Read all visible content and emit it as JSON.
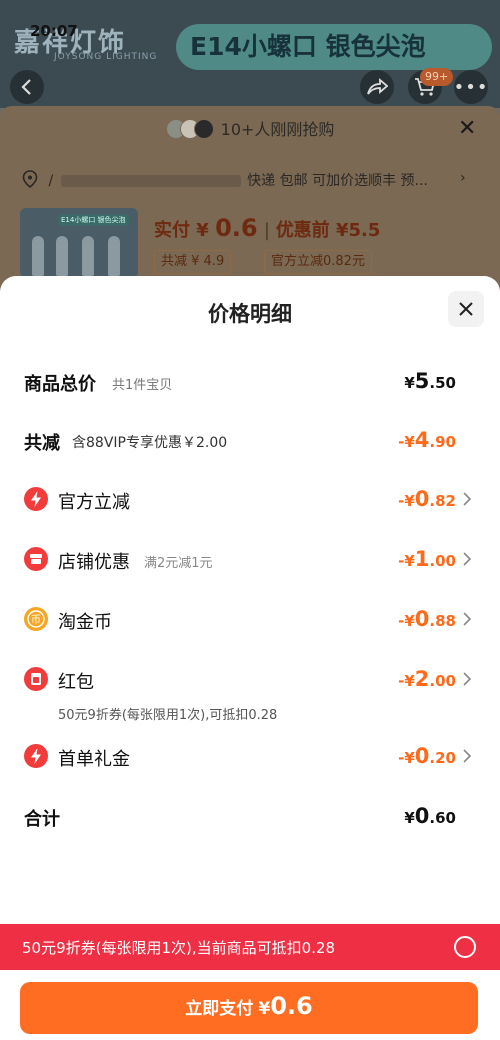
{
  "status_bar": {
    "time": "20:07"
  },
  "background_page": {
    "brand_logo_text": "嘉祥灯饰",
    "brand_logo_sub": "JOYSONG LIGHTING",
    "banner_text": "E14小螺口 银色尖泡",
    "cart_badge": "99+",
    "rush_text": "10+人刚刚抢购",
    "address_prefix": "/",
    "shipping_text": "快递 包邮 可加价选顺丰 预...",
    "product_img_tag": "E14小螺口 银色尖泡",
    "price_label": "实付",
    "price_currency": "¥",
    "price_value": "0.6",
    "price_before_label": "优惠前",
    "price_before_value": "¥5.5",
    "chips": [
      "共减 ¥ 4.9",
      "官方立减0.82元"
    ]
  },
  "modal": {
    "title": "价格明细",
    "total": {
      "label": "商品总价",
      "sub": "共1件宝贝",
      "currency": "¥",
      "int": "5",
      "dec": ".50"
    },
    "reduce": {
      "label": "共减",
      "sub": "含88VIP专享优惠￥2.00",
      "prefix": "-¥",
      "int": "4",
      "dec": ".90"
    },
    "items": [
      {
        "label": "官方立减",
        "sub": "",
        "prefix": "-¥",
        "int": "0",
        "dec": ".82",
        "icon": "lightning-icon",
        "color": "#f23b3b"
      },
      {
        "label": "店铺优惠",
        "sub": "满2元减1元",
        "prefix": "-¥",
        "int": "1",
        "dec": ".00",
        "icon": "shop-icon",
        "color": "#f23b3b"
      },
      {
        "label": "淘金币",
        "sub": "",
        "prefix": "-¥",
        "int": "0",
        "dec": ".88",
        "icon": "coin-icon",
        "color": "#f5a623"
      },
      {
        "label": "红包",
        "sub": "",
        "prefix": "-¥",
        "int": "2",
        "dec": ".00",
        "icon": "red-packet-icon",
        "color": "#f23b3b"
      },
      {
        "label": "首单礼金",
        "sub": "",
        "prefix": "-¥",
        "int": "0",
        "dec": ".20",
        "icon": "lightning-icon",
        "color": "#f23b3b"
      }
    ],
    "redpack_note": "50元9折券(每张限用1次),可抵扣0.28",
    "sum": {
      "label": "合计",
      "currency": "¥",
      "int": "0",
      "dec": ".60"
    }
  },
  "coupon_bar": {
    "text": "50元9折券(每张限用1次),当前商品可抵扣0.28",
    "selected": false
  },
  "pay_button": {
    "label": "立即支付",
    "currency": "¥",
    "amount": "0.6"
  },
  "colors": {
    "accent": "#ff6d22",
    "discount": "#ff6a1a",
    "coupon_bar": "#ef2f43"
  }
}
